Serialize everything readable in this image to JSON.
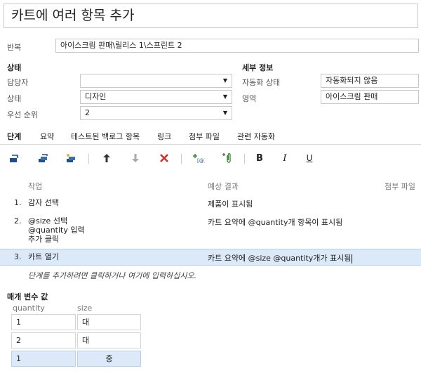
{
  "title": "카트에 여러 항목 추가",
  "iteration": {
    "label": "반복",
    "value": "아이스크림 판매\\릴리스 1\\스프린트 2"
  },
  "status": {
    "heading": "상태",
    "assigned_label": "담당자",
    "assigned_value": "",
    "state_label": "상태",
    "state_value": "디자인",
    "priority_label": "우선 순위",
    "priority_value": "2"
  },
  "details": {
    "heading": "세부 정보",
    "automation_label": "자동화 상태",
    "automation_value": "자동화되지 않음",
    "area_label": "영역",
    "area_value": "아이스크림 판매"
  },
  "tabs": [
    "단계",
    "요약",
    "테스트된 백로그 항목",
    "링크",
    "첨부 파일",
    "관련 자동화"
  ],
  "toolbar": {
    "bold": "B",
    "italic": "I",
    "underline": "U"
  },
  "steps": {
    "col_action": "작업",
    "col_expected": "예상 결과",
    "col_attachments": "첨부 파일",
    "rows": [
      {
        "num": "1.",
        "action": [
          "감자 선택"
        ],
        "expected": "제품이 표시됨"
      },
      {
        "num": "2.",
        "action": [
          "@size 선택",
          "@quantity 입력",
          "추가 클릭"
        ],
        "expected": "카트 요약에 @quantity개 항목이 표시됨"
      },
      {
        "num": "3.",
        "action": [
          "카트 열기"
        ],
        "expected": "카트 요약에 @size @quantity개가 표시됨"
      }
    ],
    "hint": "단계를 추가하려면 클릭하거나 여기에 입력하십시오."
  },
  "params": {
    "title": "매개 변수 값",
    "headers": [
      "quantity",
      "size"
    ],
    "rows": [
      [
        "1",
        "대"
      ],
      [
        "2",
        "대"
      ],
      [
        "1",
        "중"
      ]
    ]
  },
  "colors": {
    "selection": "#dce9f8",
    "delete": "#c8302c",
    "link_icon": "#3a8a3a"
  }
}
